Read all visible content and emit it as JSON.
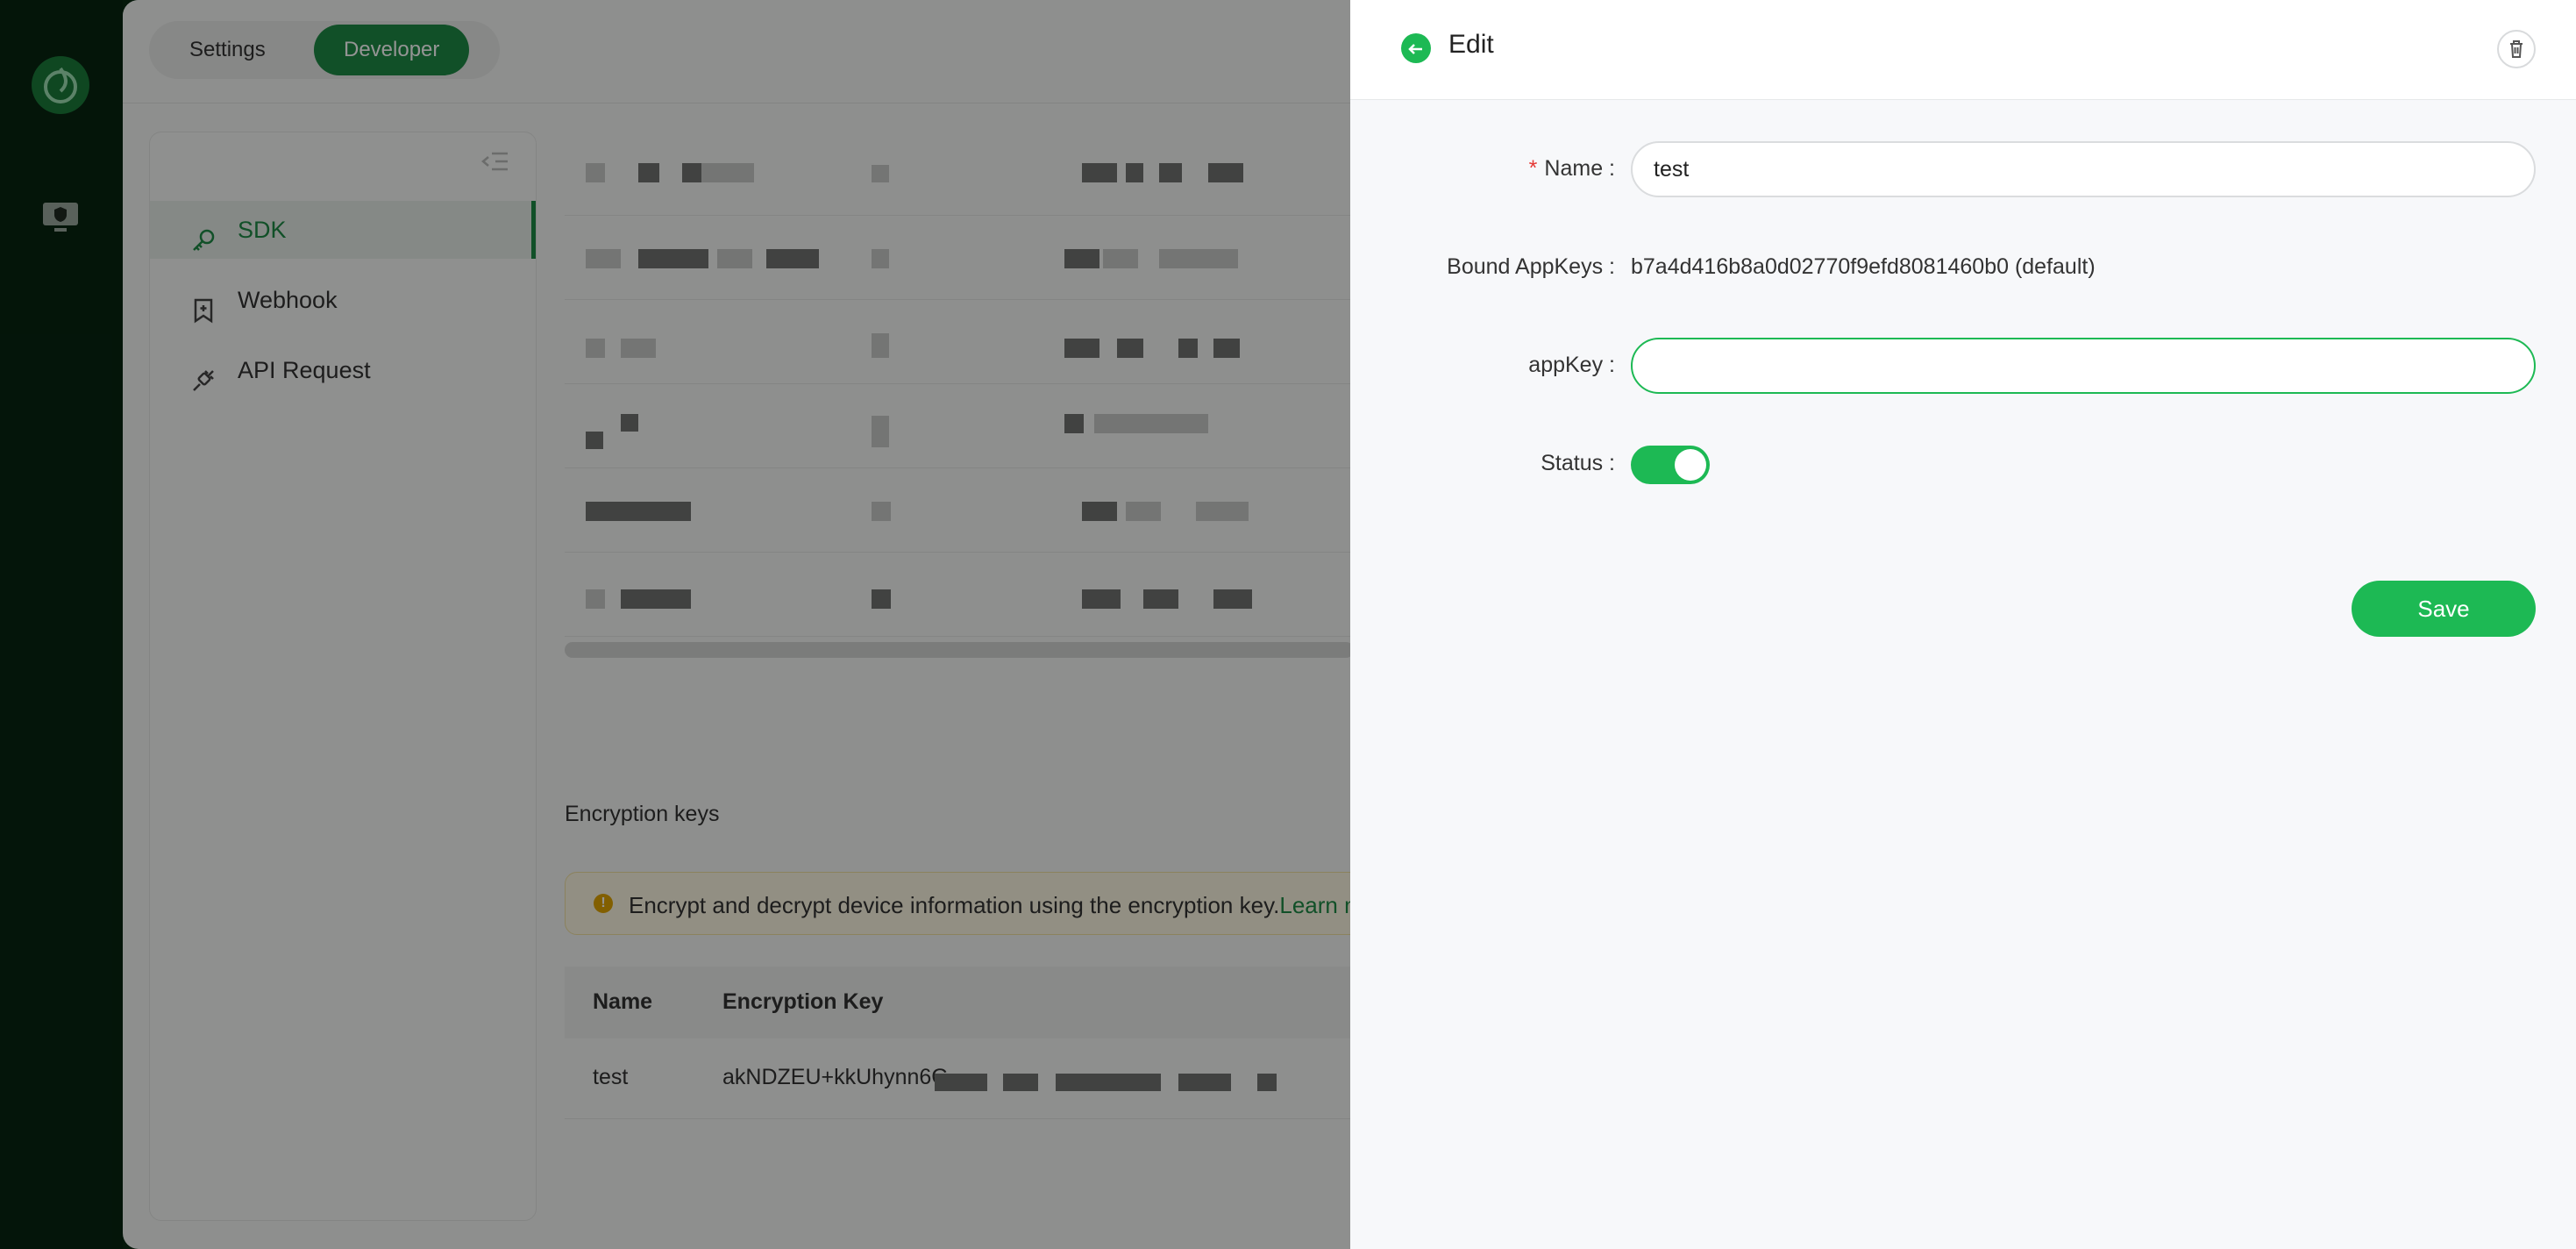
{
  "topbar": {
    "tabs": [
      {
        "label": "Settings"
      },
      {
        "label": "Developer"
      }
    ]
  },
  "sidenav": {
    "items": [
      {
        "label": "SDK",
        "icon": "key-icon"
      },
      {
        "label": "Webhook",
        "icon": "bookmark-icon"
      },
      {
        "label": "API Request",
        "icon": "plug-icon"
      }
    ]
  },
  "encryption": {
    "title": "Encryption keys",
    "alert_text": "Encrypt and decrypt device information using the encryption key.",
    "alert_link": "Learn m",
    "columns": [
      "Name",
      "Encryption Key"
    ],
    "rows": [
      {
        "name": "test",
        "key": "akNDZEU+kkUhynn6G"
      }
    ]
  },
  "drawer": {
    "title": "Edit",
    "name_label": "Name",
    "name_value": "test",
    "bound_label": "Bound AppKeys",
    "bound_value": "b7a4d416b8a0d02770f9efd8081460b0 (default)",
    "appkey_label": "appKey",
    "appkey_value": "",
    "status_label": "Status",
    "status_on": true,
    "save_label": "Save"
  },
  "colors": {
    "accent": "#1db954",
    "brand_dark": "#1e8a45",
    "rail": "#072511"
  }
}
